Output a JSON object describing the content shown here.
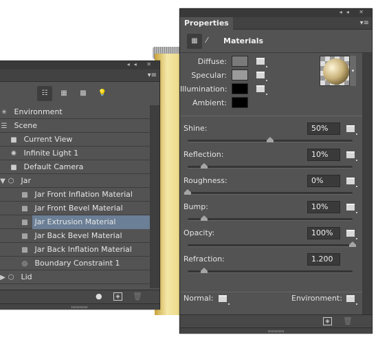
{
  "scene_panel": {
    "toolbar_icons": [
      "scene-filter-icon",
      "mesh-filter-icon",
      "material-filter-icon",
      "light-filter-icon"
    ],
    "items": [
      {
        "label": "Environment",
        "icon": "environment-icon",
        "indent": 0
      },
      {
        "label": "Scene",
        "icon": "scene-icon",
        "indent": 0
      },
      {
        "label": "Current View",
        "icon": "camera-icon",
        "indent": 1
      },
      {
        "label": "Infinite Light 1",
        "icon": "light-icon",
        "indent": 1
      },
      {
        "label": "Default Camera",
        "icon": "camera-icon",
        "indent": 1
      },
      {
        "label": "Jar",
        "icon": "mesh-icon",
        "indent": 0,
        "expanded": true
      },
      {
        "label": "Jar Front Inflation Material",
        "icon": "material-icon",
        "indent": 2
      },
      {
        "label": "Jar Front Bevel Material",
        "icon": "material-icon",
        "indent": 2
      },
      {
        "label": "Jar Extrusion Material",
        "icon": "material-icon",
        "indent": 2,
        "selected": true
      },
      {
        "label": "Jar Back Bevel Material",
        "icon": "material-icon",
        "indent": 2
      },
      {
        "label": "Jar Back Inflation Material",
        "icon": "material-icon",
        "indent": 2
      },
      {
        "label": "Boundary Constraint 1",
        "icon": "constraint-icon",
        "indent": 2
      },
      {
        "label": "Lid",
        "icon": "mesh-icon",
        "indent": 0,
        "expanded": false
      }
    ]
  },
  "properties": {
    "tab": "Properties",
    "section_title": "Materials",
    "colors": [
      {
        "label": "Diffuse:",
        "color": "#7a7a7a"
      },
      {
        "label": "Specular:",
        "color": "#9a9a9a"
      },
      {
        "label": "Illumination:",
        "color": "#000000"
      },
      {
        "label": "Ambient:",
        "color": "#000000"
      }
    ],
    "sliders": [
      {
        "label": "Shine:",
        "value": "50%",
        "fraction": 0.5
      },
      {
        "label": "Reflection:",
        "value": "10%",
        "fraction": 0.1
      },
      {
        "label": "Roughness:",
        "value": "0%",
        "fraction": 0
      },
      {
        "label": "Bump:",
        "value": "10%",
        "fraction": 0.1
      },
      {
        "label": "Opacity:",
        "value": "100%",
        "fraction": 1
      },
      {
        "label": "Refraction:",
        "value": "1.200",
        "fraction": 0.1
      }
    ],
    "normal_label": "Normal:",
    "environment_label": "Environment:"
  }
}
